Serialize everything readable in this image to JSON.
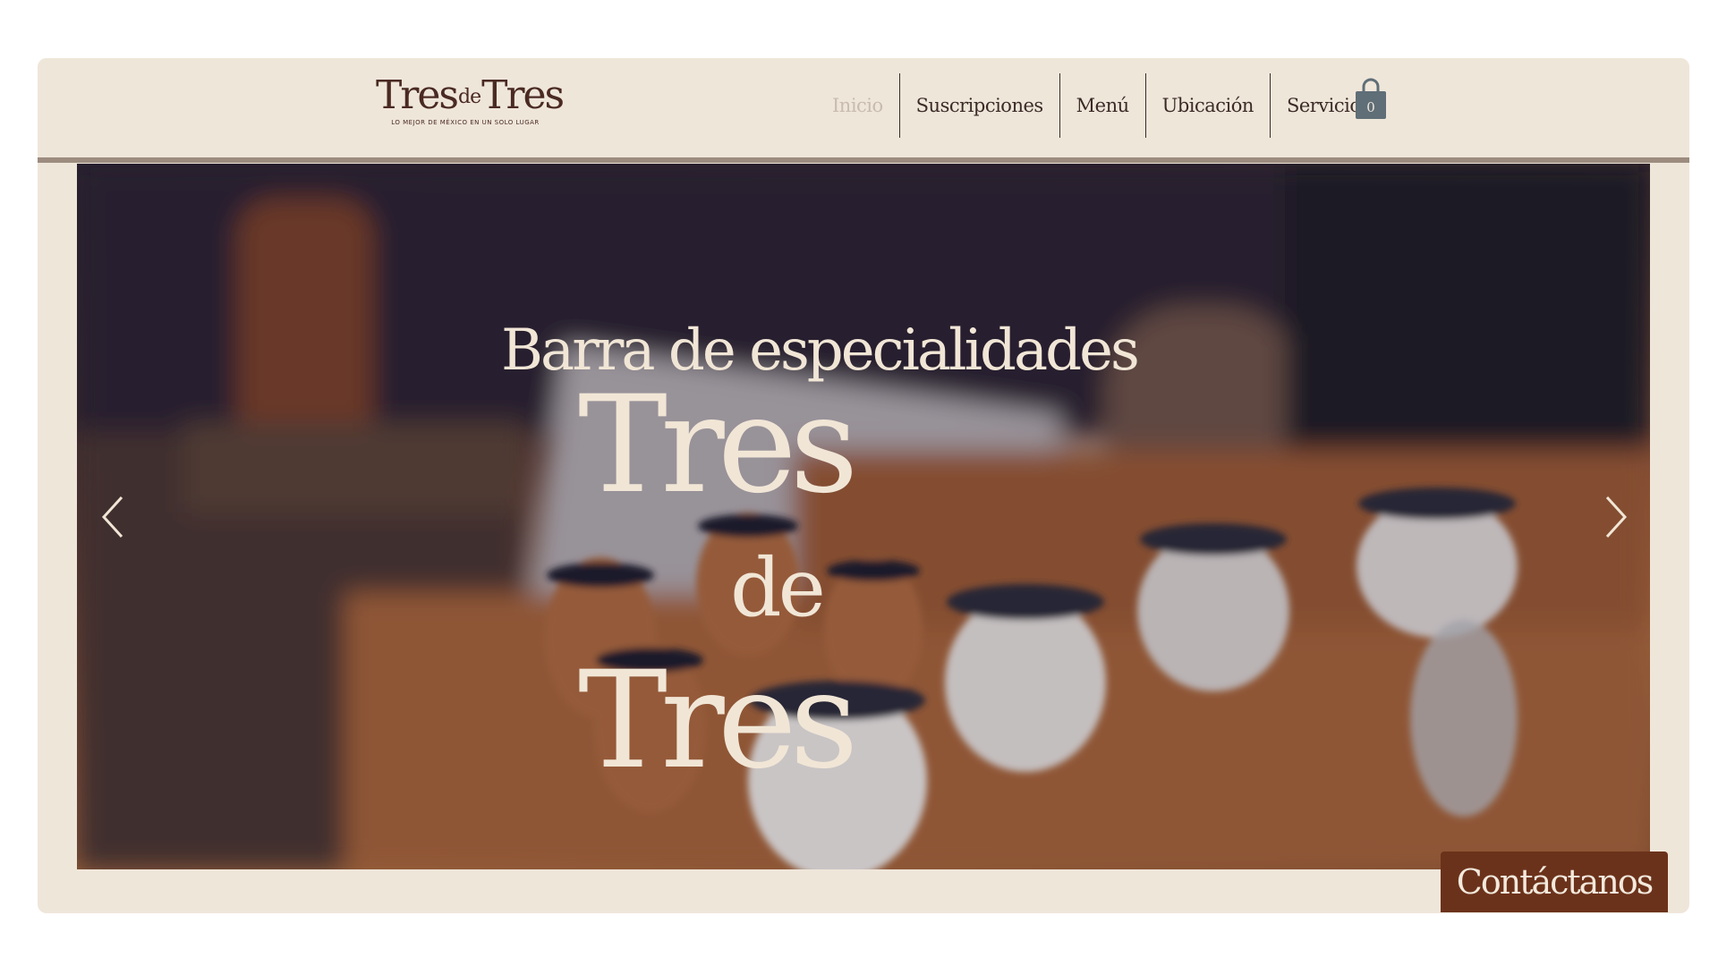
{
  "brand": {
    "logo_first": "Tres",
    "logo_mid": "de",
    "logo_last": "Tres",
    "tagline": "LO MEJOR DE MÉXICO EN UN SOLO LUGAR"
  },
  "nav": {
    "items": [
      {
        "label": "Inicio",
        "active": true
      },
      {
        "label": "Suscripciones",
        "active": false
      },
      {
        "label": "Menú",
        "active": false
      },
      {
        "label": "Ubicación",
        "active": false
      },
      {
        "label": "Servicios",
        "active": false
      }
    ]
  },
  "cart": {
    "count": "0",
    "icon": "shopping-bag-icon"
  },
  "hero": {
    "subtitle": "Barra de especialidades",
    "line1": "Tres",
    "line2": "de",
    "line3": "Tres",
    "prev_icon": "chevron-left-icon",
    "next_icon": "chevron-right-icon"
  },
  "contact": {
    "label": "Contáctanos"
  },
  "colors": {
    "background": "#efe6da",
    "brand_brown": "#4a2a22",
    "contact_button": "#6b321b",
    "hero_text": "#f1e6d6"
  }
}
